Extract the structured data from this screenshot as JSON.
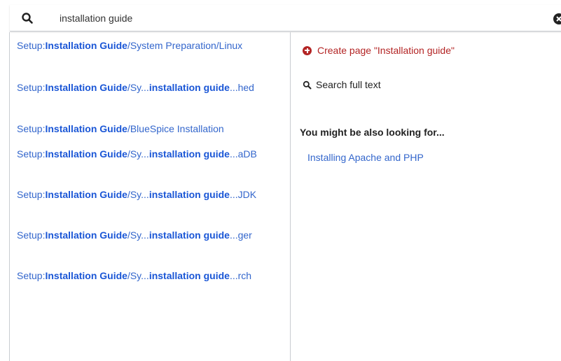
{
  "search": {
    "value": "installation guide",
    "placeholder": "",
    "search_icon": "search-icon",
    "clear_icon": "clear-circle-icon"
  },
  "results": [
    {
      "prefix": "Setup:",
      "bold1": "Installation Guide",
      "mid": "/System Preparation/Linux",
      "bold2": "",
      "suffix": ""
    },
    {
      "prefix": "Setup:",
      "bold1": "Installation Guide",
      "mid": "/Sy...",
      "bold2": "installation guide",
      "suffix": "...hed"
    },
    {
      "prefix": "Setup:",
      "bold1": "Installation Guide",
      "mid": "/BlueSpice Installation",
      "bold2": "",
      "suffix": ""
    },
    {
      "prefix": "Setup:",
      "bold1": "Installation Guide",
      "mid": "/Sy...",
      "bold2": "installation guide",
      "suffix": "...aDB"
    },
    {
      "prefix": "Setup:",
      "bold1": "Installation Guide",
      "mid": "/Sy...",
      "bold2": "installation guide",
      "suffix": "...JDK"
    },
    {
      "prefix": "Setup:",
      "bold1": "Installation Guide",
      "mid": "/Sy...",
      "bold2": "installation guide",
      "suffix": "...ger"
    },
    {
      "prefix": "Setup:",
      "bold1": "Installation Guide",
      "mid": "/Sy...",
      "bold2": "installation guide",
      "suffix": "...rch"
    }
  ],
  "actions": {
    "create_page": "Create page \"Installation guide\"",
    "search_full_text": "Search full text"
  },
  "lookup": {
    "heading": "You might be also looking for...",
    "items": [
      "Installing Apache and PHP"
    ]
  },
  "colors": {
    "link": "#3366cc",
    "create": "#b32424",
    "border": "#c8ccd1"
  }
}
